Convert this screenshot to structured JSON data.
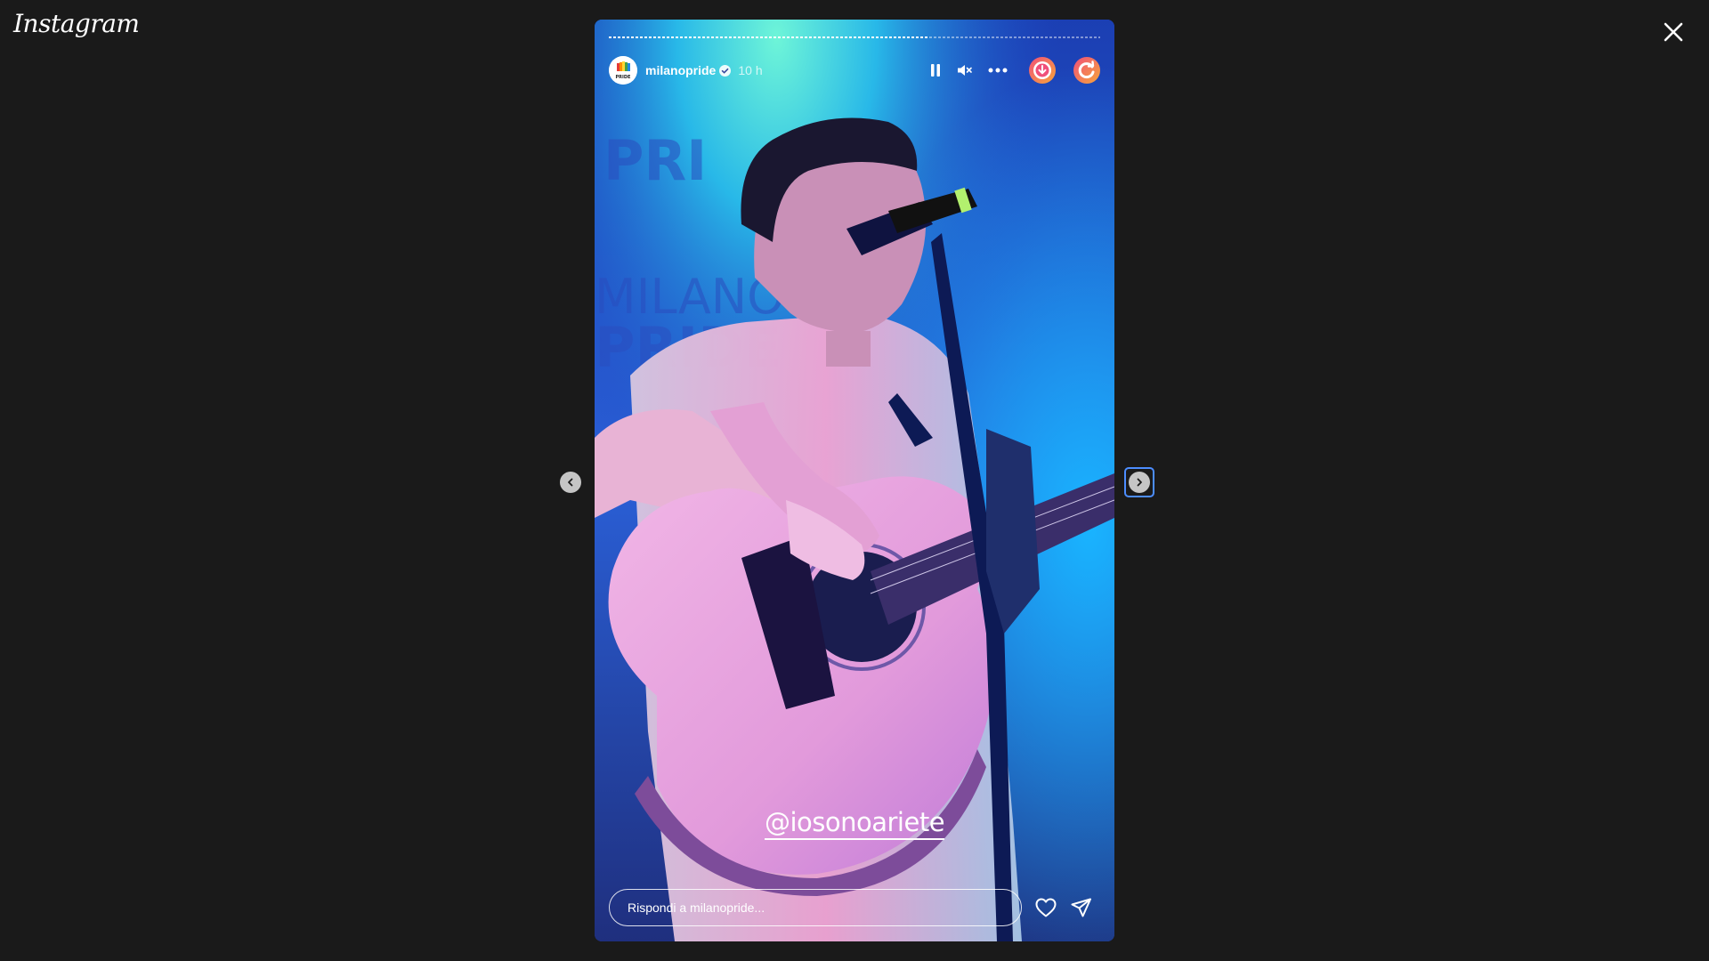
{
  "app": {
    "logo_text": "Instagram"
  },
  "story": {
    "username": "milanopride",
    "time_ago": "10 h",
    "progress_fraction": 0.65,
    "mention": "@iosonoariete",
    "reply_placeholder": "Rispondi a milanopride...",
    "avatar_text": "MILANO PRIDE"
  },
  "icons": {
    "close": "close-icon",
    "pause": "pause-icon",
    "mute": "mute-icon",
    "more": "more-options-icon",
    "extension_1": "download-extension-icon",
    "extension_2": "refresh-extension-icon",
    "like": "heart-icon",
    "share": "send-icon",
    "prev": "chevron-left-icon",
    "next": "chevron-right-icon",
    "verified": "verified-badge-icon"
  },
  "colors": {
    "background": "#1a1a1a",
    "focus_outline": "#4c8dff",
    "extension_gradient_a": "#f0507a",
    "extension_gradient_b": "#f7a63a"
  }
}
